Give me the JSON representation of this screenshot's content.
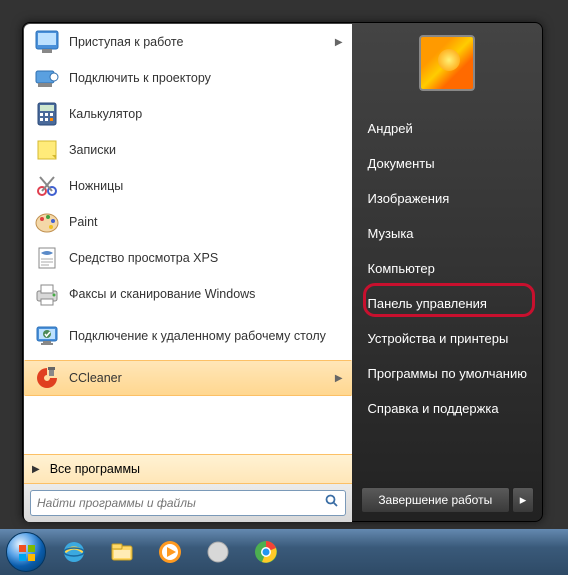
{
  "programs": [
    {
      "label": "Приступая к работе",
      "icon": "getting-started",
      "arrow": true
    },
    {
      "label": "Подключить к проектору",
      "icon": "projector"
    },
    {
      "label": "Калькулятор",
      "icon": "calculator"
    },
    {
      "label": "Записки",
      "icon": "sticky-notes"
    },
    {
      "label": "Ножницы",
      "icon": "snipping-tool"
    },
    {
      "label": "Paint",
      "icon": "paint"
    },
    {
      "label": "Средство просмотра XPS",
      "icon": "xps-viewer"
    },
    {
      "label": "Факсы и сканирование Windows",
      "icon": "fax-scan"
    },
    {
      "label": "Подключение к удаленному рабочему столу",
      "icon": "remote-desktop",
      "tall": true
    }
  ],
  "recent": {
    "label": "CCleaner",
    "icon": "ccleaner",
    "arrow": true
  },
  "all_programs": "Все программы",
  "search": {
    "placeholder": "Найти программы и файлы"
  },
  "user": "Андрей",
  "right_links": [
    {
      "key": "user",
      "label": "Андрей"
    },
    {
      "key": "documents",
      "label": "Документы"
    },
    {
      "key": "pictures",
      "label": "Изображения"
    },
    {
      "key": "music",
      "label": "Музыка"
    },
    {
      "key": "computer",
      "label": "Компьютер"
    },
    {
      "key": "control",
      "label": "Панель управления",
      "highlighted": true
    },
    {
      "key": "devices",
      "label": "Устройства и принтеры"
    },
    {
      "key": "defaults",
      "label": "Программы по умолчанию"
    },
    {
      "key": "help",
      "label": "Справка и поддержка"
    }
  ],
  "shutdown": "Завершение работы",
  "taskbar": [
    {
      "key": "start",
      "icon": "windows-orb"
    },
    {
      "key": "ie",
      "icon": "internet-explorer"
    },
    {
      "key": "explorer",
      "icon": "file-explorer"
    },
    {
      "key": "wmp",
      "icon": "media-player"
    },
    {
      "key": "unknown",
      "icon": "app"
    },
    {
      "key": "chrome",
      "icon": "chrome"
    }
  ]
}
